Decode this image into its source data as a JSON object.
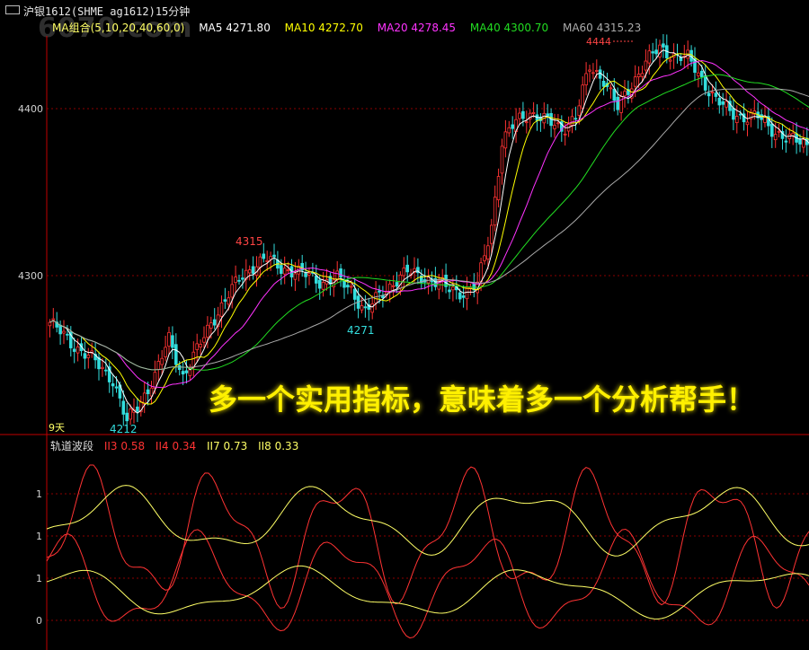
{
  "header": {
    "title": "沪银1612(SHME ag1612)15分钟",
    "watermark": "6070.com"
  },
  "ma_legend": [
    {
      "key": "group",
      "label": "MA组合(5,10,20,40,60,0)",
      "color": "#ffff66"
    },
    {
      "key": "ma5",
      "label": "MA5 4271.80",
      "color": "#ffffff"
    },
    {
      "key": "ma10",
      "label": "MA10 4272.70",
      "color": "#ffff00"
    },
    {
      "key": "ma20",
      "label": "MA20 4278.45",
      "color": "#ff33ff"
    },
    {
      "key": "ma40",
      "label": "MA40 4300.70",
      "color": "#22dd22"
    },
    {
      "key": "ma60",
      "label": "MA60 4315.23",
      "color": "#aaaaaa"
    }
  ],
  "indicator_legend": [
    {
      "key": "name",
      "label": "轨道波段",
      "color": "#dddddd"
    },
    {
      "key": "ii3",
      "label": "II3  0.58",
      "color": "#ff3333"
    },
    {
      "key": "ii4",
      "label": "II4  0.34",
      "color": "#ff3333"
    },
    {
      "key": "ii7",
      "label": "II7  0.73",
      "color": "#ffff66"
    },
    {
      "key": "ii8",
      "label": "II8  0.33",
      "color": "#ffff66"
    }
  ],
  "banner": "多一个实用指标，意味着多一个分析帮手！",
  "period_label": "9天",
  "annotations": [
    {
      "key": "high",
      "text": "4444",
      "color": "#ff4444"
    },
    {
      "key": "peak",
      "text": "4315",
      "color": "#ff4444"
    },
    {
      "key": "mid_low",
      "text": "4271",
      "color": "#33dddd"
    },
    {
      "key": "low",
      "text": "4212",
      "color": "#33dddd"
    }
  ],
  "price_axis": {
    "ticks": [
      "4400",
      "4300"
    ],
    "labels": {
      "t4400": "4400",
      "t4300": "4300"
    }
  },
  "indicator_axis": {
    "labels": [
      "1",
      "1",
      "1",
      "0"
    ]
  },
  "colors": {
    "up": "#ff3333",
    "down": "#33dddd",
    "bg": "#000000",
    "grid": "#8b0000"
  },
  "chart_data": [
    {
      "type": "candlestick",
      "title": "沪银1612(SHME ag1612)15分钟",
      "ylim": [
        4200,
        4450
      ],
      "yticks": [
        4300,
        4400
      ],
      "anchors": [
        [
          0,
          4272
        ],
        [
          6,
          4260
        ],
        [
          12,
          4250
        ],
        [
          18,
          4238
        ],
        [
          22,
          4212
        ],
        [
          26,
          4225
        ],
        [
          30,
          4240
        ],
        [
          34,
          4262
        ],
        [
          38,
          4240
        ],
        [
          42,
          4255
        ],
        [
          46,
          4272
        ],
        [
          50,
          4285
        ],
        [
          54,
          4298
        ],
        [
          58,
          4306
        ],
        [
          62,
          4310
        ],
        [
          66,
          4305
        ],
        [
          70,
          4302
        ],
        [
          74,
          4300
        ],
        [
          78,
          4296
        ],
        [
          82,
          4298
        ],
        [
          86,
          4292
        ],
        [
          90,
          4278
        ],
        [
          94,
          4288
        ],
        [
          98,
          4296
        ],
        [
          102,
          4302
        ],
        [
          106,
          4300
        ],
        [
          110,
          4296
        ],
        [
          114,
          4292
        ],
        [
          118,
          4290
        ],
        [
          122,
          4294
        ],
        [
          126,
          4330
        ],
        [
          129,
          4380
        ],
        [
          133,
          4392
        ],
        [
          137,
          4398
        ],
        [
          142,
          4392
        ],
        [
          146,
          4388
        ],
        [
          150,
          4395
        ],
        [
          154,
          4425
        ],
        [
          158,
          4418
        ],
        [
          162,
          4400
        ],
        [
          166,
          4415
        ],
        [
          170,
          4428
        ],
        [
          174,
          4436
        ],
        [
          178,
          4432
        ],
        [
          182,
          4430
        ],
        [
          186,
          4418
        ],
        [
          190,
          4405
        ],
        [
          194,
          4398
        ],
        [
          198,
          4395
        ],
        [
          202,
          4395
        ],
        [
          206,
          4388
        ],
        [
          210,
          4382
        ],
        [
          214,
          4380
        ],
        [
          218,
          4378
        ]
      ],
      "ma": {
        "ma5": 4271.8,
        "ma10": 4272.7,
        "ma20": 4278.45,
        "ma40": 4300.7,
        "ma60": 4315.23
      }
    },
    {
      "type": "line",
      "title": "轨道波段",
      "series": [
        {
          "name": "II3",
          "color": "#ff3333",
          "values": [
            0.58
          ]
        },
        {
          "name": "II4",
          "color": "#ff3333",
          "values": [
            0.34
          ]
        },
        {
          "name": "II7",
          "color": "#ffff66",
          "values": [
            0.73
          ]
        },
        {
          "name": "II8",
          "color": "#ffff66",
          "values": [
            0.33
          ]
        }
      ]
    }
  ]
}
